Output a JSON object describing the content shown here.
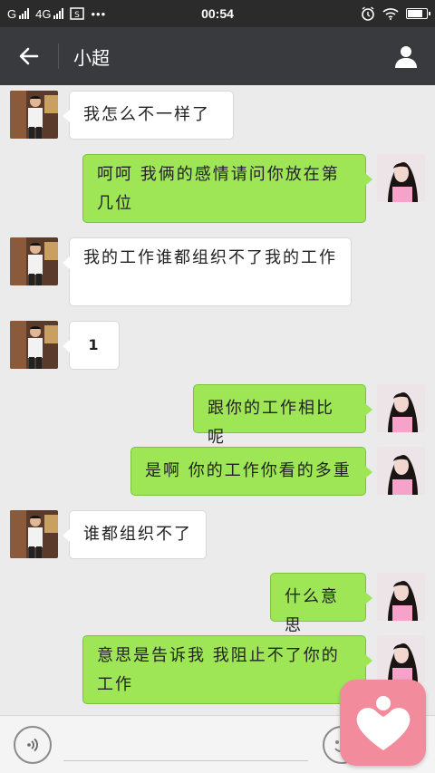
{
  "status_bar": {
    "carrier_1": "G",
    "carrier_2": "4G",
    "time": "00:54",
    "battery_level": 0.85
  },
  "header": {
    "title": "小超",
    "back_icon": "arrow-left-icon",
    "profile_icon": "person-icon"
  },
  "messages": [
    {
      "side": "left",
      "sender_avatar": "man-avatar",
      "text": "我怎么不一样了"
    },
    {
      "side": "right",
      "sender_avatar": "woman-avatar",
      "text": "呵呵 我俩的感情请问你放在第几位"
    },
    {
      "side": "left",
      "sender_avatar": "man-avatar",
      "text": "我的工作谁都组织不了我的工作"
    },
    {
      "side": "left",
      "sender_avatar": "man-avatar",
      "text": "1"
    },
    {
      "side": "right",
      "sender_avatar": "woman-avatar",
      "text": "跟你的工作相比呢"
    },
    {
      "side": "right",
      "sender_avatar": "woman-avatar",
      "text": "是啊 你的工作你看的多重"
    },
    {
      "side": "left",
      "sender_avatar": "man-avatar",
      "text": "谁都组织不了"
    },
    {
      "side": "right",
      "sender_avatar": "woman-avatar",
      "text": "什么意思"
    },
    {
      "side": "right",
      "sender_avatar": "woman-avatar",
      "text": "意思是告诉我 我阻止不了你的工作"
    }
  ],
  "input_bar": {
    "voice_icon": "voice-icon",
    "input_value": "",
    "emoji_icon": "emoji-icon"
  },
  "overlay": {
    "icon": "heart-app-icon"
  },
  "colors": {
    "status_bar_bg": "#2b2b2b",
    "title_bar_bg": "#393a3e",
    "chat_bg": "#ebebeb",
    "bubble_sent": "#9fe657",
    "bubble_received": "#ffffff",
    "overlay_pink": "#f28b9b"
  }
}
